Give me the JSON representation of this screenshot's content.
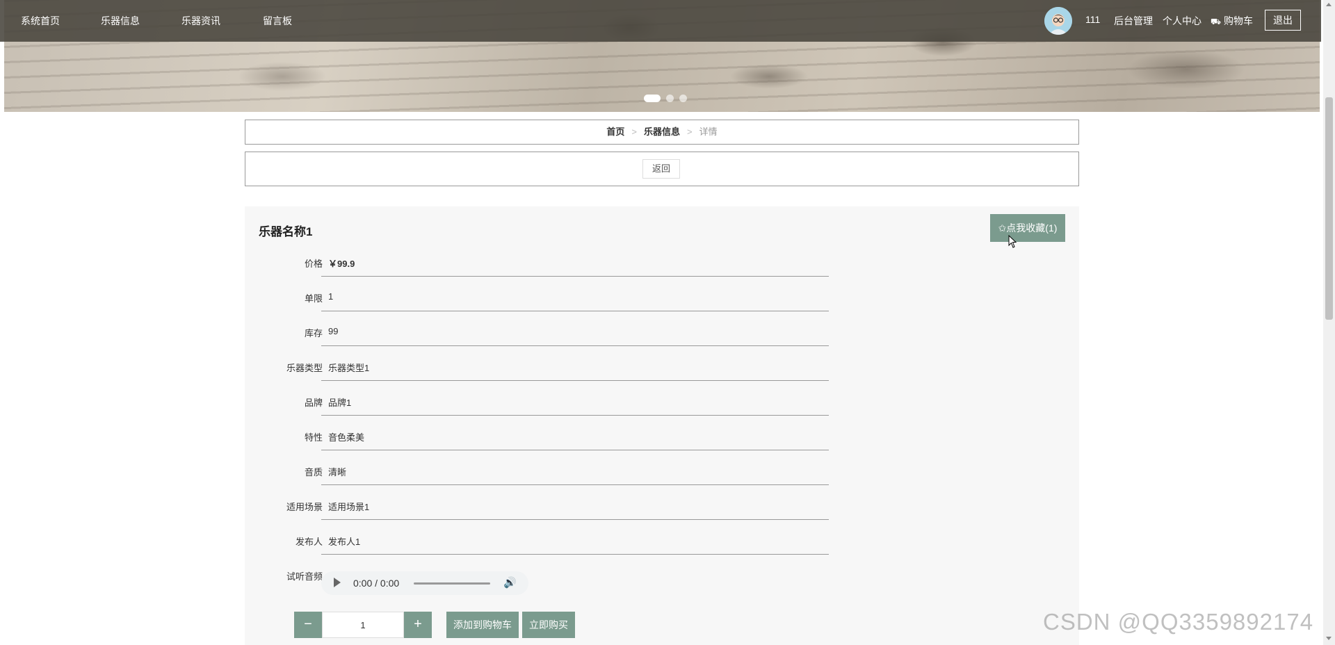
{
  "nav": {
    "items": [
      "系统首页",
      "乐器信息",
      "乐器资讯",
      "留言板"
    ],
    "user_name": "111",
    "admin": "后台管理",
    "profile": "个人中心",
    "cart_icon": "cart-icon",
    "cart": "购物车",
    "logout": "退出"
  },
  "banner": {
    "slides": 3,
    "active_slide": 1
  },
  "breadcrumb": {
    "home": "首页",
    "category": "乐器信息",
    "current": "详情",
    "separator": ">"
  },
  "back_label": "返回",
  "detail": {
    "title": "乐器名称1",
    "favorite_label": "✩点我收藏(1)",
    "fields": [
      {
        "label": "价格",
        "value": "￥99.9"
      },
      {
        "label": "单限",
        "value": "1"
      },
      {
        "label": "库存",
        "value": "99"
      },
      {
        "label": "乐器类型",
        "value": "乐器类型1"
      },
      {
        "label": "品牌",
        "value": "品牌1"
      },
      {
        "label": "特性",
        "value": "音色柔美"
      },
      {
        "label": "音质",
        "value": "清晰"
      },
      {
        "label": "适用场景",
        "value": "适用场景1"
      },
      {
        "label": "发布人",
        "value": "发布人1"
      }
    ],
    "audio_label": "试听音频",
    "audio_time": "0:00 / 0:00",
    "quantity": "1",
    "minus": "−",
    "plus": "+",
    "add_to_cart": "添加到购物车",
    "buy_now": "立即购买"
  },
  "watermark": "CSDN @QQ3359892174"
}
